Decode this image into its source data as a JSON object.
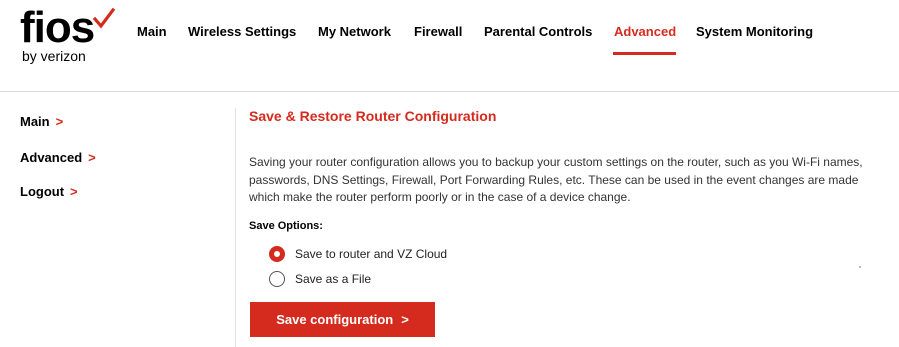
{
  "brand": {
    "logo_text": "fios",
    "logo_sub": "by verizon",
    "accent": "#d52b1e"
  },
  "nav": {
    "items": [
      {
        "label": "Main"
      },
      {
        "label": "Wireless Settings"
      },
      {
        "label": "My Network"
      },
      {
        "label": "Firewall"
      },
      {
        "label": "Parental Controls"
      },
      {
        "label": "Advanced",
        "active": true
      },
      {
        "label": "System Monitoring"
      }
    ]
  },
  "sidebar": {
    "items": [
      {
        "label": "Main",
        "icon": "chevron-right-icon"
      },
      {
        "label": "Advanced",
        "icon": "chevron-right-icon"
      },
      {
        "label": "Logout",
        "icon": "chevron-right-icon"
      }
    ]
  },
  "main": {
    "title": "Save & Restore Router Configuration",
    "description": "Saving your router configuration allows you to backup your custom settings on the router, such as you Wi-Fi names, passwords, DNS Settings, Firewall, Port Forwarding Rules, etc. These can be used in the event changes are made which make the router perform poorly or in the case of a device change.",
    "options_label": "Save Options:",
    "options": [
      {
        "label": "Save to router and VZ Cloud",
        "selected": true
      },
      {
        "label": "Save as a File",
        "selected": false
      }
    ],
    "save_button": "Save configuration",
    "chevron": ">"
  }
}
